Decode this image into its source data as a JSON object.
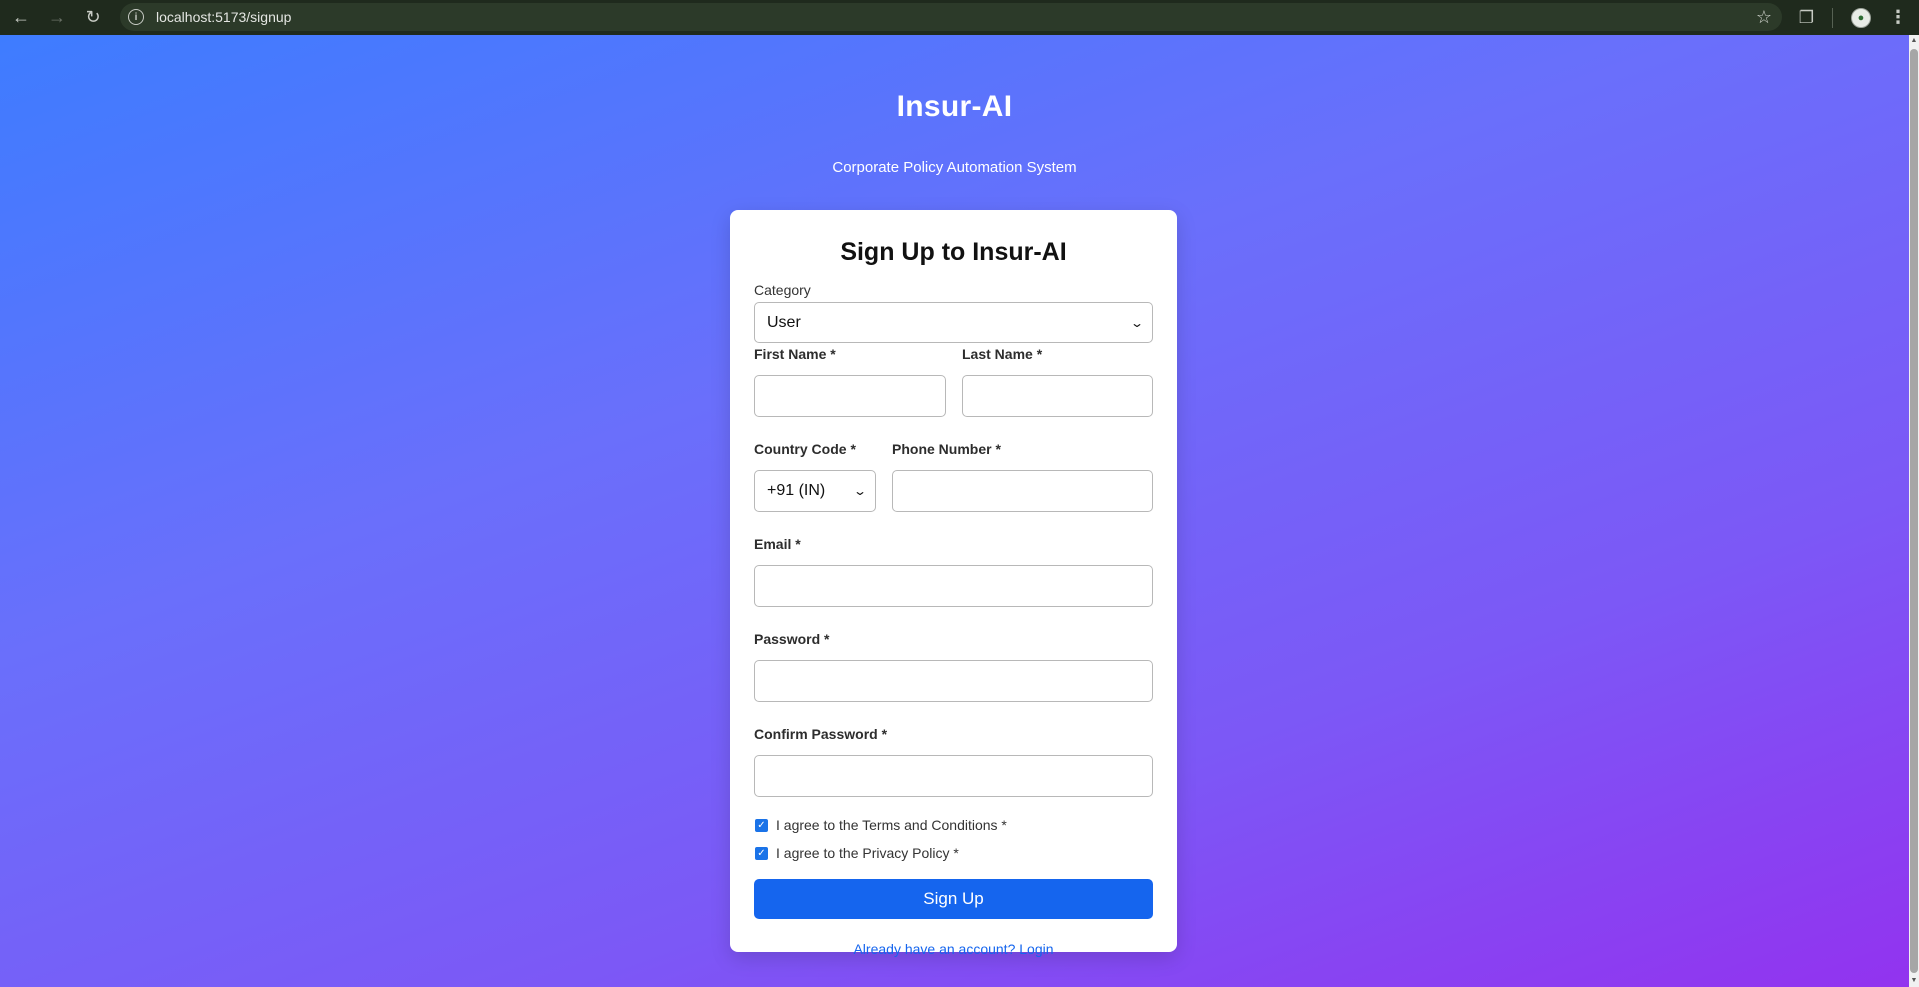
{
  "browser": {
    "url": "localhost:5173/signup",
    "back_icon": "arrow-left-icon",
    "forward_icon": "arrow-right-icon",
    "reload_icon": "reload-icon"
  },
  "header": {
    "brand": "Insur-AI",
    "tagline": "Corporate Policy Automation System"
  },
  "form": {
    "title": "Sign Up to Insur-AI",
    "category": {
      "label": "Category",
      "value": "User"
    },
    "first_name": {
      "label": "First Name *",
      "value": ""
    },
    "last_name": {
      "label": "Last Name *",
      "value": ""
    },
    "country_code": {
      "label": "Country Code *",
      "value": "+91 (IN)"
    },
    "phone": {
      "label": "Phone Number *",
      "value": ""
    },
    "email": {
      "label": "Email *",
      "value": ""
    },
    "password": {
      "label": "Password *",
      "value": ""
    },
    "confirm_password": {
      "label": "Confirm Password *",
      "value": ""
    },
    "terms": {
      "label": "I agree to the Terms and Conditions *",
      "checked": true
    },
    "privacy": {
      "label": "I agree to the Privacy Policy *",
      "checked": true
    },
    "submit_label": "Sign Up",
    "login_link": "Already have an account? Login"
  },
  "colors": {
    "accent": "#1565ee",
    "gradient_start": "#3e7cff",
    "gradient_end": "#9233ef"
  }
}
